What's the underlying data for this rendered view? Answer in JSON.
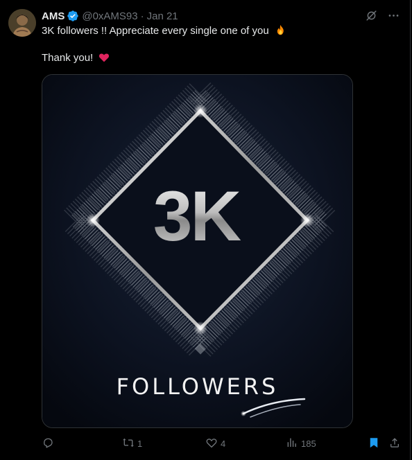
{
  "tweet": {
    "display_name": "AMS",
    "handle": "@0xAMS93",
    "separator": "·",
    "date": "Jan 21",
    "line1": "3K followers !! Appreciate every single one of you",
    "line1_emoji": "fire-emoji",
    "line2": "Thank you!",
    "line2_emoji": "red-heart-emoji"
  },
  "media": {
    "big_text": "3K",
    "caption": "FOLLOWERS"
  },
  "actions": {
    "reply_count": "",
    "retweet_count": "1",
    "like_count": "4",
    "views_count": "185"
  },
  "colors": {
    "background": "#000000",
    "text": "#e7e9ea",
    "muted": "#71767b",
    "verified": "#1d9bf0",
    "bookmark_active": "#1d9bf0",
    "heart": "#e0245e",
    "fire": "#ff8a00"
  },
  "icons": {
    "verified": "verified-badge-icon",
    "grok": "grok-icon",
    "more": "more-icon",
    "reply": "reply-icon",
    "retweet": "retweet-icon",
    "like": "heart-icon",
    "views": "views-icon",
    "bookmark": "bookmark-icon",
    "share": "share-icon"
  }
}
